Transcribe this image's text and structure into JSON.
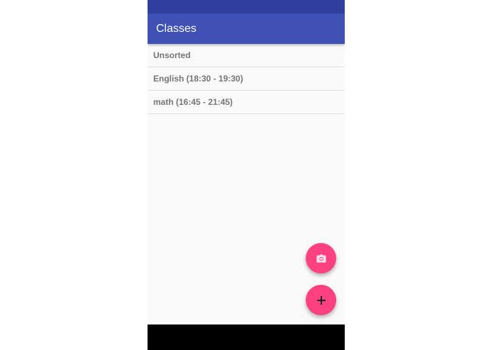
{
  "app_bar": {
    "title": "Classes"
  },
  "class_list": {
    "items": [
      {
        "label": "Unsorted"
      },
      {
        "label": "English (18:30 - 19:30)"
      },
      {
        "label": "math (16:45 - 21:45)"
      }
    ]
  },
  "fabs": {
    "camera_icon": "camera-icon",
    "add_icon": "plus-icon"
  },
  "colors": {
    "status_bar": "#303f9f",
    "app_bar": "#3f51b5",
    "accent": "#ff4081",
    "background": "#fafafa",
    "list_text": "#757575"
  }
}
